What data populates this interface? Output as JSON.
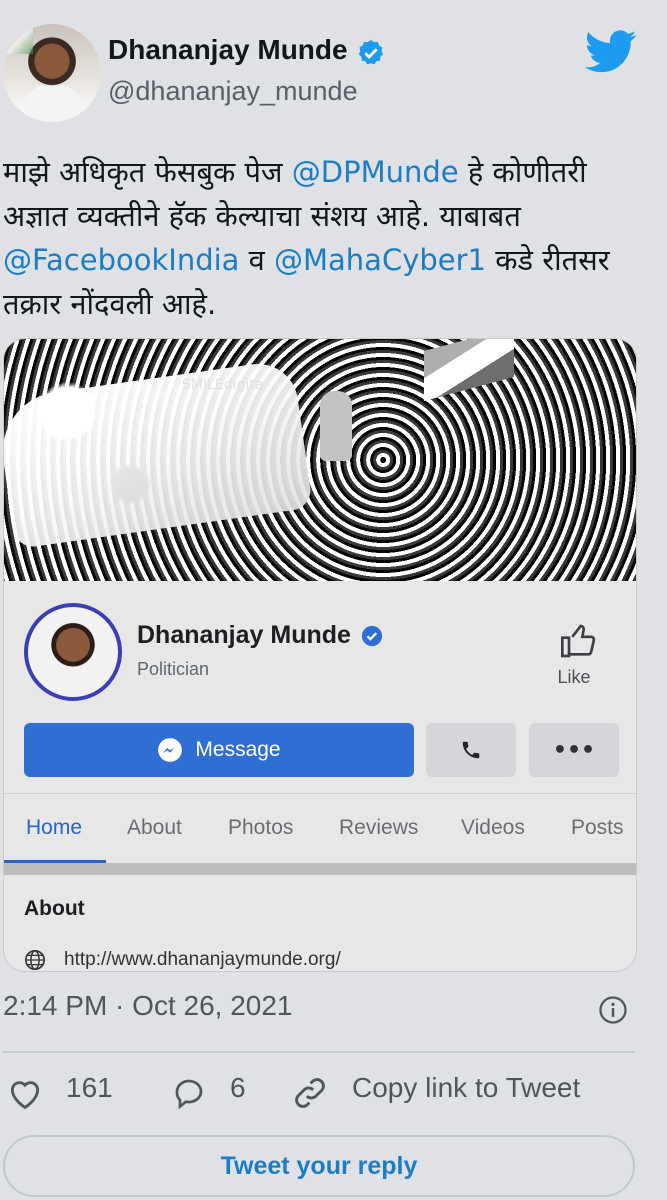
{
  "author": {
    "name": "Dhananjay Munde",
    "handle": "@dhananjay_munde",
    "verified": true
  },
  "tweet": {
    "text_parts": [
      {
        "t": "माझे अधिकृत फेसबुक पेज ",
        "mention": false
      },
      {
        "t": "@DPMunde",
        "mention": true
      },
      {
        "t": " हे कोणीतरी अज्ञात व्यक्तीने हॅक केल्याचा संशय आहे. याबाबत ",
        "mention": false
      },
      {
        "t": "@FacebookIndia",
        "mention": true
      },
      {
        "t": " व ",
        "mention": false
      },
      {
        "t": "@MahaCyber1",
        "mention": true
      },
      {
        "t": " कडे रीतसर तक्रार नोंदवली आहे.",
        "mention": false
      }
    ]
  },
  "card": {
    "cover_banner_text": "SMILEdigita",
    "page_name": "Dhananjay Munde",
    "page_category": "Politician",
    "like_label": "Like",
    "message_label": "Message",
    "more_label": "•••",
    "tabs": [
      "Home",
      "About",
      "Photos",
      "Reviews",
      "Videos",
      "Posts"
    ],
    "active_tab": "Home",
    "about_heading": "About",
    "about_link": "http://www.dhananjaymunde.org/"
  },
  "meta": {
    "timestamp": "2:14 PM · Oct 26, 2021"
  },
  "actions": {
    "likes": "161",
    "replies": "6",
    "copy_link": "Copy link to Tweet",
    "reply_button": "Tweet your reply"
  },
  "colors": {
    "link": "#1b7ec4",
    "fb_blue": "#2f6fd4",
    "twitter_blue": "#1d9bf0"
  }
}
